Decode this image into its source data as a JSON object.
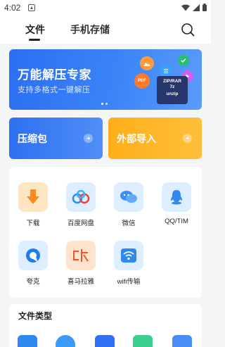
{
  "status_bar": {
    "time": "4:02"
  },
  "tabs": [
    {
      "label": "文件",
      "active": true
    },
    {
      "label": "手机存储",
      "active": false
    }
  ],
  "banner": {
    "title": "万能解压专家",
    "subtitle": "支持多格式一键解压",
    "zip_label_1": "ZIP/RAR",
    "zip_label_2": "7z",
    "zip_label_3": "unzip",
    "pdf_label": "PDF"
  },
  "actions": {
    "compress": "压缩包",
    "import": "外部导入"
  },
  "tools": [
    {
      "name": "下载",
      "icon": "download-icon"
    },
    {
      "name": "百度网盘",
      "icon": "baidu-netdisk-icon"
    },
    {
      "name": "微信",
      "icon": "wechat-icon"
    },
    {
      "name": "QQ/TIM",
      "icon": "qq-icon"
    },
    {
      "name": "夸克",
      "icon": "quark-icon"
    },
    {
      "name": "喜马拉雅",
      "icon": "ximalaya-icon"
    },
    {
      "name": "wifi传输",
      "icon": "wifi-icon"
    }
  ],
  "file_types": {
    "heading": "文件类型"
  },
  "colors": {
    "accent_blue": "#2b6ff2",
    "accent_orange": "#ffae1a"
  }
}
